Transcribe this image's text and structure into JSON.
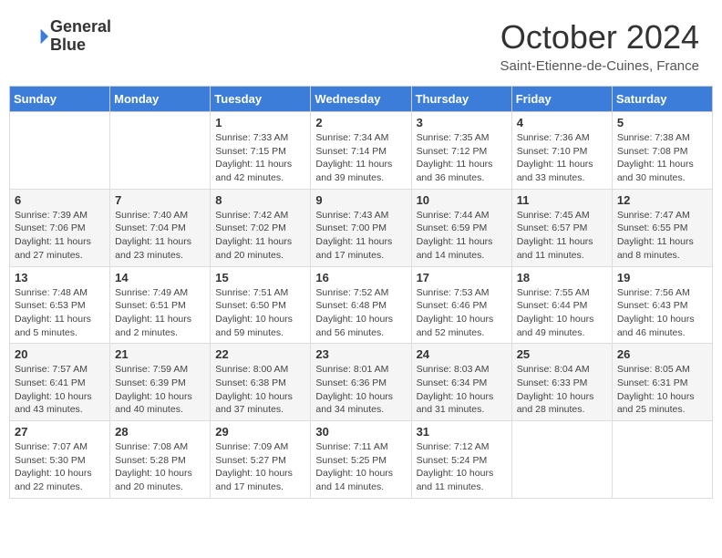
{
  "header": {
    "logo_line1": "General",
    "logo_line2": "Blue",
    "month_title": "October 2024",
    "location": "Saint-Etienne-de-Cuines, France"
  },
  "days_of_week": [
    "Sunday",
    "Monday",
    "Tuesday",
    "Wednesday",
    "Thursday",
    "Friday",
    "Saturday"
  ],
  "weeks": [
    [
      {
        "day": "",
        "info": ""
      },
      {
        "day": "",
        "info": ""
      },
      {
        "day": "1",
        "info": "Sunrise: 7:33 AM\nSunset: 7:15 PM\nDaylight: 11 hours and 42 minutes."
      },
      {
        "day": "2",
        "info": "Sunrise: 7:34 AM\nSunset: 7:14 PM\nDaylight: 11 hours and 39 minutes."
      },
      {
        "day": "3",
        "info": "Sunrise: 7:35 AM\nSunset: 7:12 PM\nDaylight: 11 hours and 36 minutes."
      },
      {
        "day": "4",
        "info": "Sunrise: 7:36 AM\nSunset: 7:10 PM\nDaylight: 11 hours and 33 minutes."
      },
      {
        "day": "5",
        "info": "Sunrise: 7:38 AM\nSunset: 7:08 PM\nDaylight: 11 hours and 30 minutes."
      }
    ],
    [
      {
        "day": "6",
        "info": "Sunrise: 7:39 AM\nSunset: 7:06 PM\nDaylight: 11 hours and 27 minutes."
      },
      {
        "day": "7",
        "info": "Sunrise: 7:40 AM\nSunset: 7:04 PM\nDaylight: 11 hours and 23 minutes."
      },
      {
        "day": "8",
        "info": "Sunrise: 7:42 AM\nSunset: 7:02 PM\nDaylight: 11 hours and 20 minutes."
      },
      {
        "day": "9",
        "info": "Sunrise: 7:43 AM\nSunset: 7:00 PM\nDaylight: 11 hours and 17 minutes."
      },
      {
        "day": "10",
        "info": "Sunrise: 7:44 AM\nSunset: 6:59 PM\nDaylight: 11 hours and 14 minutes."
      },
      {
        "day": "11",
        "info": "Sunrise: 7:45 AM\nSunset: 6:57 PM\nDaylight: 11 hours and 11 minutes."
      },
      {
        "day": "12",
        "info": "Sunrise: 7:47 AM\nSunset: 6:55 PM\nDaylight: 11 hours and 8 minutes."
      }
    ],
    [
      {
        "day": "13",
        "info": "Sunrise: 7:48 AM\nSunset: 6:53 PM\nDaylight: 11 hours and 5 minutes."
      },
      {
        "day": "14",
        "info": "Sunrise: 7:49 AM\nSunset: 6:51 PM\nDaylight: 11 hours and 2 minutes."
      },
      {
        "day": "15",
        "info": "Sunrise: 7:51 AM\nSunset: 6:50 PM\nDaylight: 10 hours and 59 minutes."
      },
      {
        "day": "16",
        "info": "Sunrise: 7:52 AM\nSunset: 6:48 PM\nDaylight: 10 hours and 56 minutes."
      },
      {
        "day": "17",
        "info": "Sunrise: 7:53 AM\nSunset: 6:46 PM\nDaylight: 10 hours and 52 minutes."
      },
      {
        "day": "18",
        "info": "Sunrise: 7:55 AM\nSunset: 6:44 PM\nDaylight: 10 hours and 49 minutes."
      },
      {
        "day": "19",
        "info": "Sunrise: 7:56 AM\nSunset: 6:43 PM\nDaylight: 10 hours and 46 minutes."
      }
    ],
    [
      {
        "day": "20",
        "info": "Sunrise: 7:57 AM\nSunset: 6:41 PM\nDaylight: 10 hours and 43 minutes."
      },
      {
        "day": "21",
        "info": "Sunrise: 7:59 AM\nSunset: 6:39 PM\nDaylight: 10 hours and 40 minutes."
      },
      {
        "day": "22",
        "info": "Sunrise: 8:00 AM\nSunset: 6:38 PM\nDaylight: 10 hours and 37 minutes."
      },
      {
        "day": "23",
        "info": "Sunrise: 8:01 AM\nSunset: 6:36 PM\nDaylight: 10 hours and 34 minutes."
      },
      {
        "day": "24",
        "info": "Sunrise: 8:03 AM\nSunset: 6:34 PM\nDaylight: 10 hours and 31 minutes."
      },
      {
        "day": "25",
        "info": "Sunrise: 8:04 AM\nSunset: 6:33 PM\nDaylight: 10 hours and 28 minutes."
      },
      {
        "day": "26",
        "info": "Sunrise: 8:05 AM\nSunset: 6:31 PM\nDaylight: 10 hours and 25 minutes."
      }
    ],
    [
      {
        "day": "27",
        "info": "Sunrise: 7:07 AM\nSunset: 5:30 PM\nDaylight: 10 hours and 22 minutes."
      },
      {
        "day": "28",
        "info": "Sunrise: 7:08 AM\nSunset: 5:28 PM\nDaylight: 10 hours and 20 minutes."
      },
      {
        "day": "29",
        "info": "Sunrise: 7:09 AM\nSunset: 5:27 PM\nDaylight: 10 hours and 17 minutes."
      },
      {
        "day": "30",
        "info": "Sunrise: 7:11 AM\nSunset: 5:25 PM\nDaylight: 10 hours and 14 minutes."
      },
      {
        "day": "31",
        "info": "Sunrise: 7:12 AM\nSunset: 5:24 PM\nDaylight: 10 hours and 11 minutes."
      },
      {
        "day": "",
        "info": ""
      },
      {
        "day": "",
        "info": ""
      }
    ]
  ]
}
